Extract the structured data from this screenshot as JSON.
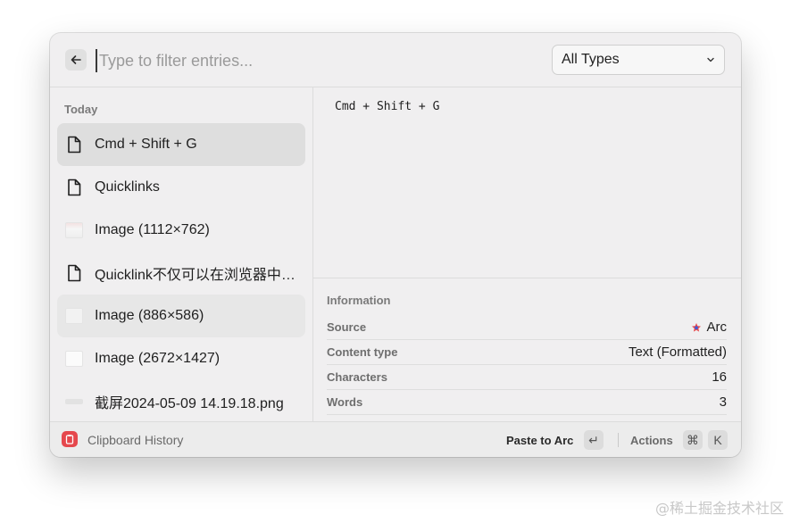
{
  "search": {
    "placeholder": "Type to filter entries..."
  },
  "filter": {
    "selected": "All Types"
  },
  "list": {
    "section_title": "Today",
    "items": [
      {
        "label": "Cmd + Shift + G",
        "icon": "document-icon",
        "selected": true
      },
      {
        "label": "Quicklinks",
        "icon": "document-icon"
      },
      {
        "label": "Image (1112×762)",
        "icon": "image-thumbnail"
      },
      {
        "label": "Quicklink不仅可以在浏览器中…",
        "icon": "document-icon"
      },
      {
        "label": "Image (886×586)",
        "icon": "image-thumbnail"
      },
      {
        "label": "Image (2672×1427)",
        "icon": "image-thumbnail"
      },
      {
        "label": "截屏2024-05-09 14.19.18.png",
        "icon": "file-thumbnail"
      }
    ]
  },
  "preview": {
    "text": "Cmd + Shift + G"
  },
  "info": {
    "title": "Information",
    "rows": [
      {
        "key": "Source",
        "value": "Arc",
        "icon": "arc-icon"
      },
      {
        "key": "Content type",
        "value": "Text (Formatted)"
      },
      {
        "key": "Characters",
        "value": "16"
      },
      {
        "key": "Words",
        "value": "3"
      }
    ]
  },
  "footer": {
    "title": "Clipboard History",
    "primary_action": "Paste to Arc",
    "primary_key": "↵",
    "actions_label": "Actions",
    "actions_keys": [
      "⌘",
      "K"
    ]
  },
  "watermark": "@稀土掘金技术社区",
  "colors": {
    "accent_red": "#e5484d",
    "selected_bg": "#dedede"
  }
}
